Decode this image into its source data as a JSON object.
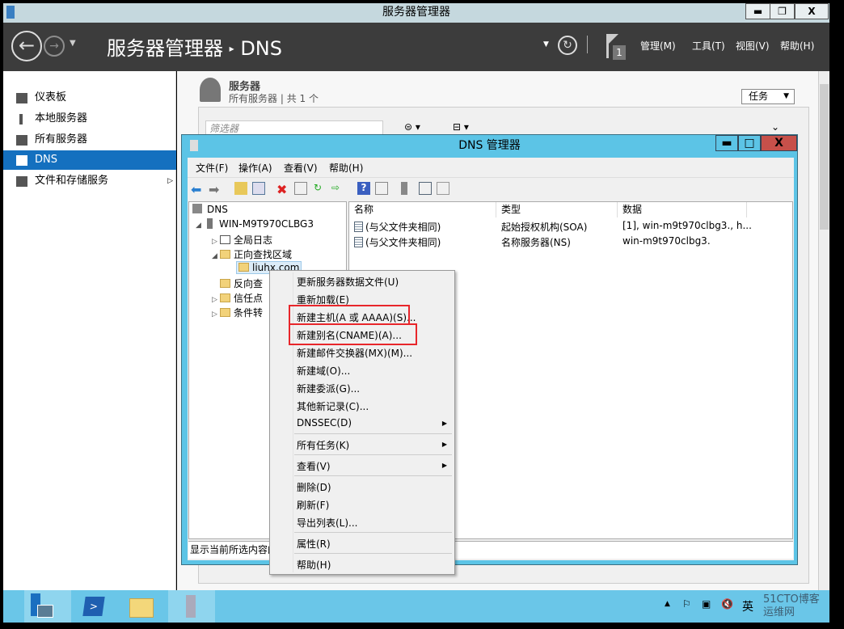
{
  "window": {
    "title": "服务器管理器",
    "minimize": "▬",
    "restore": "❐",
    "close": "X"
  },
  "header": {
    "breadcrumb_root": "服务器管理器",
    "breadcrumb_sep": "▸",
    "breadcrumb_page": "DNS",
    "notif_count": "1",
    "menus": [
      "管理(M)",
      "工具(T)",
      "视图(V)",
      "帮助(H)"
    ]
  },
  "sidebar": {
    "items": [
      {
        "label": "仪表板"
      },
      {
        "label": "本地服务器"
      },
      {
        "label": "所有服务器"
      },
      {
        "label": "DNS",
        "selected": true
      },
      {
        "label": "文件和存储服务"
      }
    ]
  },
  "servers": {
    "title": "服务器",
    "subtitle": "所有服务器",
    "count": "共 1 个",
    "tasks": "任务",
    "filter_placeholder": "筛选器"
  },
  "dns_window": {
    "title": "DNS 管理器",
    "minimize": "▬",
    "restore": "□",
    "close": "X",
    "menus": [
      "文件(F)",
      "操作(A)",
      "查看(V)",
      "帮助(H)"
    ],
    "tree": {
      "root": "DNS",
      "server": "WIN-M9T970CLBG3",
      "nodes": [
        "全局日志",
        "正向查找区域",
        "liuhx.com",
        "反向查",
        "信任点",
        "条件转"
      ]
    },
    "columns": [
      "名称",
      "类型",
      "数据"
    ],
    "rows": [
      {
        "name": "(与父文件夹相同)",
        "type": "起始授权机构(SOA)",
        "data": "[1], win-m9t970clbg3., h..."
      },
      {
        "name": "(与父文件夹相同)",
        "type": "名称服务器(NS)",
        "data": "win-m9t970clbg3."
      }
    ],
    "status": "显示当前所选内容的"
  },
  "context_menu": {
    "items": [
      "更新服务器数据文件(U)",
      "重新加载(E)",
      "新建主机(A 或 AAAA)(S)...",
      "新建别名(CNAME)(A)...",
      "新建邮件交换器(MX)(M)...",
      "新建域(O)...",
      "新建委派(G)...",
      "其他新记录(C)...",
      "DNSSEC(D)",
      "所有任务(K)",
      "查看(V)",
      "删除(D)",
      "刷新(F)",
      "导出列表(L)...",
      "属性(R)",
      "帮助(H)"
    ],
    "highlight_color": "#e8262b"
  },
  "taskbar": {
    "lang": "英",
    "watermark": "51CTO博客 运维网"
  },
  "colors": {
    "accent": "#1470bf",
    "dns_window": "#5cc4e6",
    "taskbar": "#6ac6e8"
  }
}
